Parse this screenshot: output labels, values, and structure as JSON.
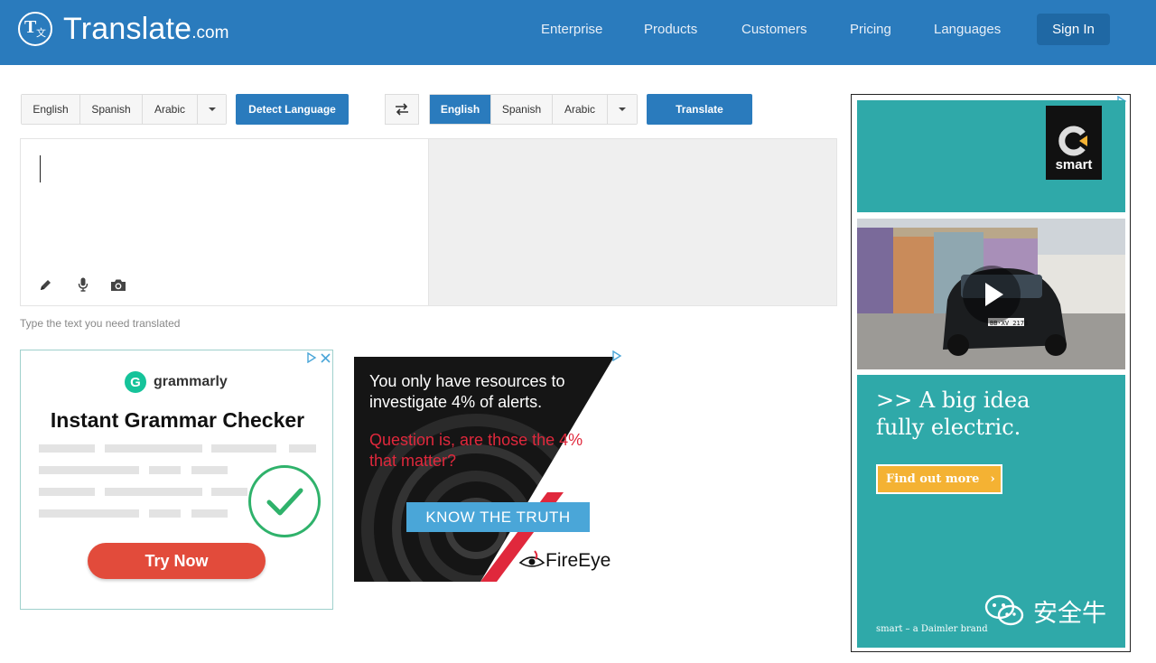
{
  "header": {
    "logo_text": "Translate",
    "logo_domain": ".com",
    "nav": [
      "Enterprise",
      "Products",
      "Customers",
      "Pricing",
      "Languages"
    ],
    "sign_in": "Sign In",
    "bar_color": "#2a7bbd"
  },
  "source": {
    "languages": [
      "English",
      "Spanish",
      "Arabic"
    ],
    "detect_button": "Detect Language",
    "hint": "Type the text you need translated",
    "tools": [
      "pencil-icon",
      "microphone-icon",
      "camera-icon"
    ]
  },
  "target": {
    "languages": [
      "English",
      "Spanish",
      "Arabic"
    ],
    "selected": "English",
    "translate_button": "Translate"
  },
  "ads": {
    "grammarly": {
      "brand": "grammarly",
      "headline": "Instant Grammar Checker",
      "cta": "Try Now"
    },
    "fireeye": {
      "line1": "You only have resources to investigate 4% of alerts.",
      "line2": "Question is, are those the 4% that matter?",
      "cta": "KNOW THE TRUTH",
      "brand": "FireEye"
    },
    "smart": {
      "logo_text": "smart",
      "headline_1": ">> A big idea",
      "headline_2": "fully electric.",
      "cta": "Find out more",
      "cta_arrow": "›",
      "footer": "smart – a Daimler brand",
      "plate": "BB·XV 2178"
    }
  },
  "watermark": "安全牛",
  "colors": {
    "primary": "#2a7bbd",
    "teal": "#2fa9a9",
    "fireeye_red": "#e0283c"
  }
}
